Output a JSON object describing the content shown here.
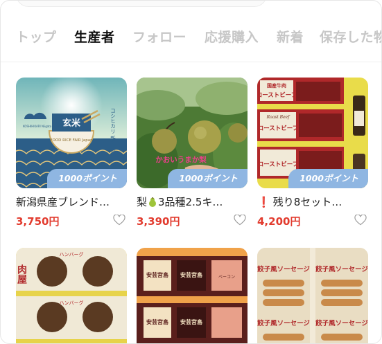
{
  "tabs": [
    {
      "label": "トップ",
      "active": false
    },
    {
      "label": "生産者",
      "active": true
    },
    {
      "label": "フォロー",
      "active": false
    },
    {
      "label": "応援購入",
      "active": false
    },
    {
      "label": "新着",
      "active": false
    },
    {
      "label": "保存した物",
      "active": false
    }
  ],
  "products": [
    {
      "title": "新潟県産ブレンド…",
      "price": "3,750円",
      "points": "1000ポイント",
      "image_text": {
        "rice": "玄米",
        "brand": "FOOD RICE FAIR Japan",
        "side": "コシヒカリ 新潟県産",
        "small": "KOSHIHIKARI Niigata Japan Variety"
      }
    },
    {
      "title_prefix": "梨",
      "title_suffix": "3品種2.5キ…",
      "price": "3,390円",
      "points": "1000ポイント",
      "image_text": {
        "caption": "かおいうまか梨"
      }
    },
    {
      "title_prefix": "❗",
      "title_suffix": "残り8セット…",
      "price": "4,200円",
      "points": "1000ポイント",
      "image_text": {
        "label_top": "国産牛肉",
        "label_main": "ローストビーフ",
        "label_sub": "Roast Beef"
      }
    },
    {
      "image_text": {
        "side": "肉屋",
        "label": "ハンバーグ"
      }
    },
    {
      "image_text": {
        "brand": "安芸宮島",
        "label": "ベーコン"
      }
    },
    {
      "image_text": {
        "label": "餃子風ソーセージ"
      }
    }
  ],
  "colors": {
    "accent_price": "#e23b2e",
    "points_badge": "#8fb6e2",
    "tab_active": "#111111",
    "tab_inactive": "#c7c7c7"
  }
}
